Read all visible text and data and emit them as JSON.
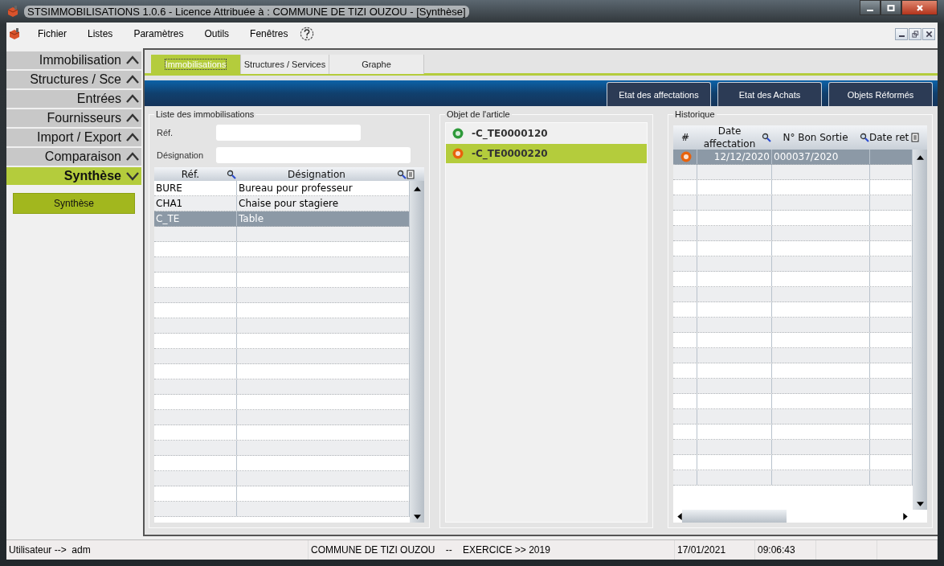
{
  "window": {
    "title": "STSIMMOBILISATIONS 1.0.6  -  Licence Attribuée à :  COMMUNE DE TIZI OUZOU - [Synthèse]"
  },
  "menu": [
    "Fichier",
    "Listes",
    "Paramètres",
    "Outils",
    "Fenêtres"
  ],
  "sidebar": {
    "sections": [
      {
        "label": "Immobilisation",
        "expanded": false
      },
      {
        "label": "Structures / Sce",
        "expanded": false
      },
      {
        "label": "Entrées",
        "expanded": false
      },
      {
        "label": "Fournisseurs",
        "expanded": false
      },
      {
        "label": "Import / Export",
        "expanded": false
      },
      {
        "label": "Comparaison",
        "expanded": false
      },
      {
        "label": "Synthèse",
        "expanded": true,
        "items": [
          "Synthèse"
        ]
      }
    ]
  },
  "tabs": [
    {
      "label": "Immobilisations",
      "selected": true
    },
    {
      "label": "Structures / Services",
      "selected": false
    },
    {
      "label": "Graphe",
      "selected": false
    }
  ],
  "toolbar": [
    "Etat des affectations",
    "Etat des Achats",
    "Objets Réformés"
  ],
  "list_panel": {
    "title": "Liste des immobilisations",
    "ref_label": "Réf.",
    "designation_label": "Désignation",
    "columns": [
      "Réf.",
      "Désignation"
    ],
    "rows": [
      {
        "ref": "BURE",
        "designation": "Bureau pour professeur",
        "selected": false
      },
      {
        "ref": "CHA1",
        "designation": "Chaise pour stagiere",
        "selected": false
      },
      {
        "ref": "C_TE",
        "designation": "Table",
        "selected": true
      }
    ]
  },
  "object_panel": {
    "title": "Objet de l'article",
    "items": [
      {
        "label": "-C_TE0000120",
        "color": "#2e9a3a",
        "selected": false
      },
      {
        "label": "-C_TE0000220",
        "color": "#e8620c",
        "selected": true
      }
    ]
  },
  "history_panel": {
    "title": "Historique",
    "columns": [
      "#",
      "Date affectation",
      "N° Bon Sortie",
      "Date ret"
    ],
    "rows": [
      {
        "color": "#e8620c",
        "date": "12/12/2020",
        "bon": "000037/2020",
        "date_ret": "",
        "selected": true
      }
    ]
  },
  "status_bar": {
    "user": "Utilisateur -->  adm",
    "entity": "COMMUNE DE TIZI OUZOU    --    EXERCICE >> 2019",
    "date": "17/01/2021",
    "time": "09:06:43"
  }
}
